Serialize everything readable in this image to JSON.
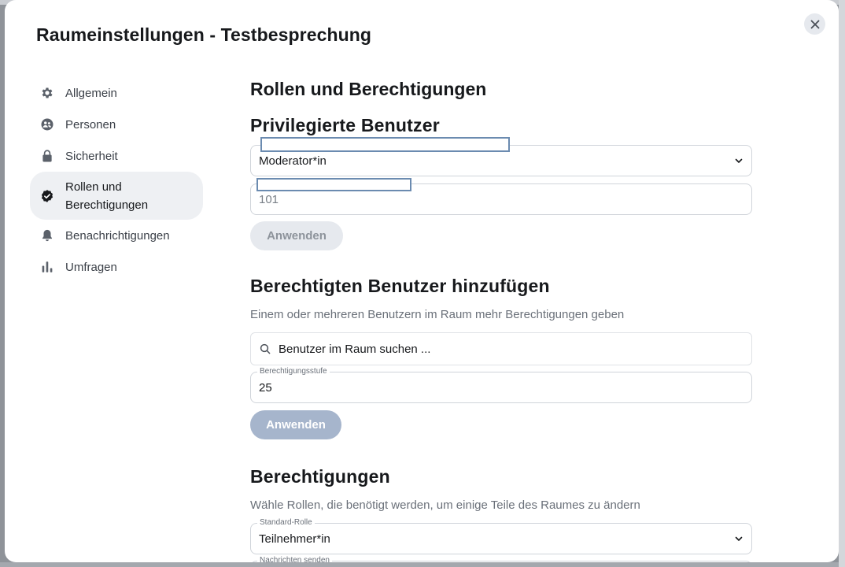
{
  "dialog": {
    "title": "Raumeinstellungen - Testbesprechung",
    "close_icon": "close-icon"
  },
  "sidebar": {
    "items": [
      {
        "label": "Allgemein",
        "icon": "gear-icon",
        "active": false
      },
      {
        "label": "Personen",
        "icon": "people-icon",
        "active": false
      },
      {
        "label": "Sicherheit",
        "icon": "lock-icon",
        "active": false
      },
      {
        "label": "Rollen und Berechtigungen",
        "label_line1": "Rollen und",
        "label_line2": "Berechtigungen",
        "icon": "verified-badge-icon",
        "active": true
      },
      {
        "label": "Benachrichtigungen",
        "icon": "bell-icon",
        "active": false
      },
      {
        "label": "Umfragen",
        "icon": "poll-icon",
        "active": false
      }
    ]
  },
  "main": {
    "page_title": "Rollen und Berechtigungen",
    "privileged": {
      "title": "Privilegierte Benutzer",
      "role_select_value": "Moderator*in",
      "level_input_value": "101",
      "apply_label": "Anwenden"
    },
    "add_user": {
      "title": "Berechtigten Benutzer hinzufügen",
      "description": "Einem oder mehreren Benutzern im Raum mehr Berechtigungen geben",
      "search_placeholder": "Benutzer im Raum suchen ...",
      "level_legend": "Berechtigungsstufe",
      "level_value": "25",
      "apply_label": "Anwenden"
    },
    "permissions": {
      "title": "Berechtigungen",
      "description": "Wähle Rollen, die benötigt werden, um einige Teile des Raumes zu ändern",
      "default_role_legend": "Standard-Rolle",
      "default_role_value": "Teilnehmer*in",
      "next_legend": "Nachrichten senden"
    }
  },
  "colors": {
    "accent_muted": "#a6b5cc",
    "disabled_bg": "#e6e9ee",
    "active_nav_bg": "#eef0f3",
    "redaction_border": "#6b8bb0"
  }
}
